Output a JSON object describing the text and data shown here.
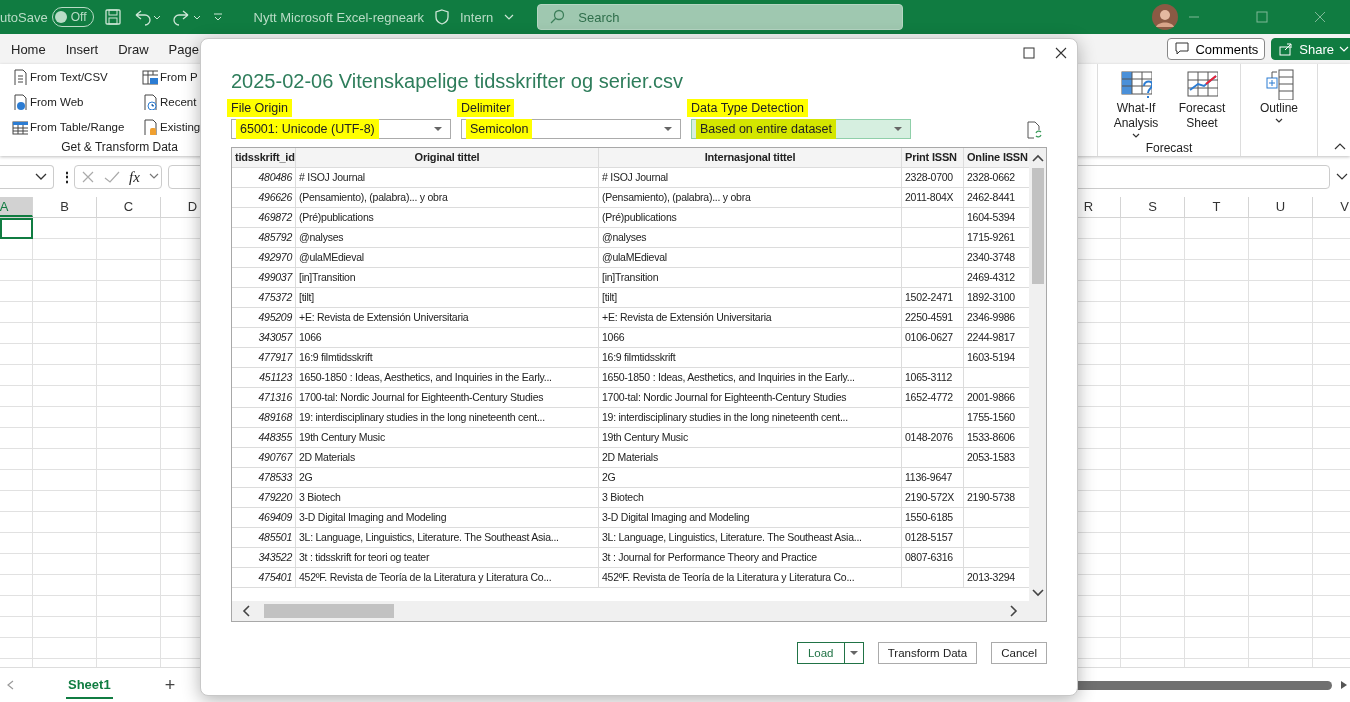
{
  "title_bar": {
    "autosave_label": "utoSave",
    "autosave_toggle": {
      "label": "Off",
      "on": false
    },
    "document_title": "Nytt Microsoft Excel-regneark",
    "sensitivity_label": "Intern",
    "search": {
      "placeholder": "Search"
    }
  },
  "ribbon": {
    "tabs": [
      "Home",
      "Insert",
      "Draw",
      "Page"
    ],
    "buttons": [
      {
        "label": "Comments",
        "kind": "comments"
      },
      {
        "label": "Share",
        "kind": "share"
      }
    ],
    "groups": [
      {
        "label": "Get & Transform Data",
        "kind": "small",
        "commands": [
          {
            "label": "From Text/CSV",
            "kind": "text-file"
          },
          {
            "label": "From Web",
            "kind": "web"
          },
          {
            "label": "From Table/Range",
            "kind": "table"
          },
          {
            "label": "From P",
            "kind": "picture"
          },
          {
            "label": "Recent",
            "kind": "recent"
          },
          {
            "label": "Existing",
            "kind": "existing"
          }
        ]
      },
      {
        "label": "Forecast",
        "kind": "large",
        "commands": [
          {
            "label": "What-If Analysis",
            "kind": "what-if",
            "dropdown": true
          },
          {
            "label": "Forecast Sheet",
            "kind": "forecast",
            "dropdown": false
          }
        ]
      },
      {
        "kind": "large",
        "commands": [
          {
            "label": "Outline",
            "kind": "outline",
            "dropdown": true
          }
        ]
      }
    ]
  },
  "formula_bar": {
    "more_label": "⋮",
    "function_label": "fx"
  },
  "sheet": {
    "columns": [
      {
        "label": "A",
        "selected": true
      },
      {
        "label": "B",
        "selected": false
      },
      {
        "label": "C",
        "selected": false
      },
      {
        "label": "D",
        "selected": false
      },
      {
        "label": "R",
        "selected": false
      },
      {
        "label": "S",
        "selected": false
      },
      {
        "label": "T",
        "selected": false
      },
      {
        "label": "U",
        "selected": false
      },
      {
        "label": "V",
        "selected": false
      }
    ],
    "tabs": [
      {
        "label": "Sheet1",
        "selected": true
      }
    ],
    "add_sheet": "+"
  },
  "dialog": {
    "title": "2025-02-06 Vitenskapelige tidsskrifter og serier.csv",
    "options": [
      {
        "label": "File Origin",
        "value": "65001: Unicode (UTF-8)",
        "highlighted": true,
        "hovered": false
      },
      {
        "label": "Delimiter",
        "value": "Semicolon",
        "highlighted": true,
        "hovered": false
      },
      {
        "label": "Data Type Detection",
        "value": "Based on entire dataset",
        "highlighted": true,
        "hovered": true
      }
    ],
    "table": {
      "columns": [
        "tidsskrift_id",
        "Original tittel",
        "Internasjonal tittel",
        "Print ISSN",
        "Online ISSN"
      ],
      "rows": [
        [
          "480486",
          "# ISOJ Journal",
          "# ISOJ Journal",
          "2328-0700",
          "2328-0662"
        ],
        [
          "496626",
          "(Pensamiento), (palabra)... y obra",
          "(Pensamiento), (palabra)... y obra",
          "2011-804X",
          "2462-8441"
        ],
        [
          "469872",
          "(Pré)publications",
          "(Pré)publications",
          null,
          "1604-5394"
        ],
        [
          "485792",
          "@nalyses",
          "@nalyses",
          null,
          "1715-9261"
        ],
        [
          "492970",
          "@ulaMEdieval",
          "@ulaMEdieval",
          null,
          "2340-3748"
        ],
        [
          "499037",
          "[in]Transition",
          "[in]Transition",
          null,
          "2469-4312"
        ],
        [
          "475372",
          "[tilt]",
          "[tilt]",
          "1502-2471",
          "1892-3100"
        ],
        [
          "495209",
          "+E: Revista de Extensión Universitaria",
          "+E: Revista de Extensión Universitaria",
          "2250-4591",
          "2346-9986"
        ],
        [
          "343057",
          "1066",
          "1066",
          "0106-0627",
          "2244-9817"
        ],
        [
          "477917",
          "16:9 filmtidsskrift",
          "16:9 filmtidsskrift",
          null,
          "1603-5194"
        ],
        [
          "451123",
          "1650-1850 : Ideas, Aesthetics, and Inquiries in the Early...",
          "1650-1850 : Ideas, Aesthetics, and Inquiries in the Early...",
          "1065-3112",
          null
        ],
        [
          "471316",
          "1700-tal: Nordic Journal for Eighteenth-Century Studies",
          "1700-tal: Nordic Journal for Eighteenth-Century Studies",
          "1652-4772",
          "2001-9866"
        ],
        [
          "489168",
          "19: interdisciplinary studies in the long nineteenth cent...",
          "19: interdisciplinary studies in the long nineteenth cent...",
          null,
          "1755-1560"
        ],
        [
          "448355",
          "19th Century Music",
          "19th Century Music",
          "0148-2076",
          "1533-8606"
        ],
        [
          "490767",
          "2D Materials",
          "2D Materials",
          null,
          "2053-1583"
        ],
        [
          "478533",
          "2G",
          "2G",
          "1136-9647",
          null
        ],
        [
          "479220",
          "3 Biotech",
          "3 Biotech",
          "2190-572X",
          "2190-5738"
        ],
        [
          "469409",
          "3-D Digital Imaging and Modeling",
          "3-D Digital Imaging and Modeling",
          "1550-6185",
          null
        ],
        [
          "485501",
          "3L: Language, Linguistics, Literature. The Southeast Asia...",
          "3L: Language, Linguistics, Literature. The Southeast Asia...",
          "0128-5157",
          null
        ],
        [
          "343522",
          "3t : tidsskrift for teori og teater",
          "3t : Journal for Performance Theory and Practice",
          "0807-6316",
          null
        ],
        [
          "475401",
          "452ºF. Revista de Teoría de la Literatura y Literatura Co...",
          "452ºF. Revista de Teoría de la Literatura y Literatura Co...",
          null,
          "2013-3294"
        ]
      ]
    },
    "buttons": [
      {
        "label": "Load",
        "kind": "split"
      },
      {
        "label": "Transform Data",
        "kind": "plain"
      },
      {
        "label": "Cancel",
        "kind": "plain"
      }
    ]
  }
}
